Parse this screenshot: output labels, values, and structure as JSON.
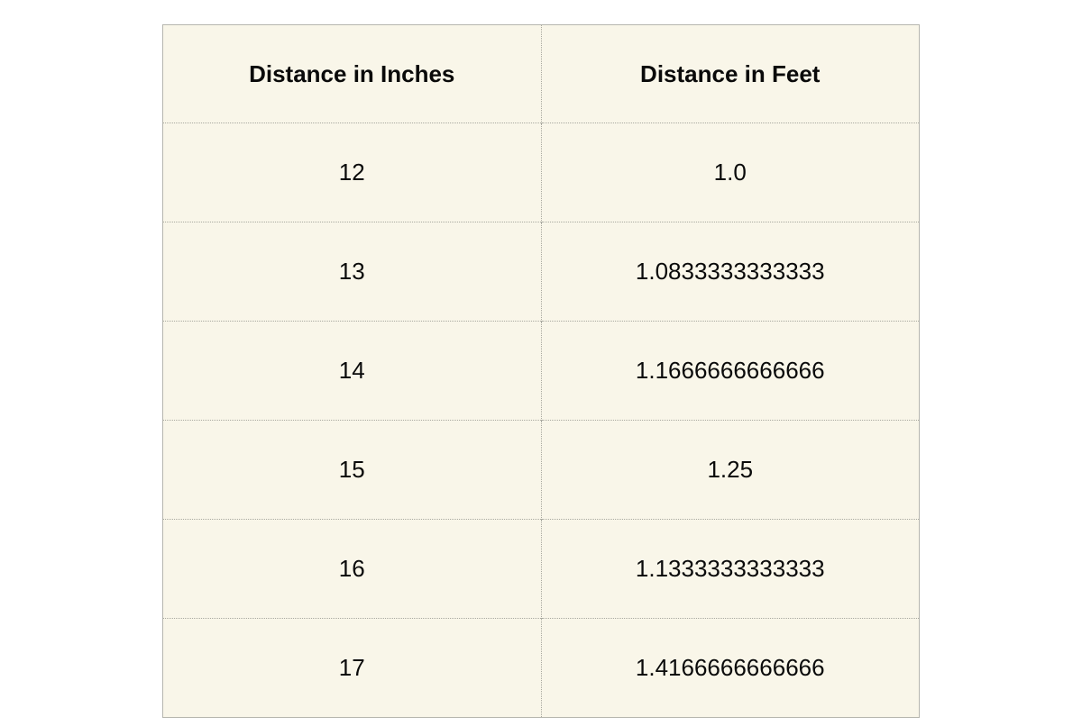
{
  "table": {
    "columns": [
      {
        "key": "inches",
        "header": "Distance in Inches"
      },
      {
        "key": "feet",
        "header": "Distance in Feet"
      }
    ],
    "rows": [
      {
        "inches": "12",
        "feet": "1.0"
      },
      {
        "inches": "13",
        "feet": "1.0833333333333"
      },
      {
        "inches": "14",
        "feet": "1.1666666666666"
      },
      {
        "inches": "15",
        "feet": "1.25"
      },
      {
        "inches": "16",
        "feet": "1.1333333333333"
      },
      {
        "inches": "17",
        "feet": "1.4166666666666"
      }
    ]
  },
  "chart_data": {
    "type": "table",
    "title": "",
    "columns": [
      "Distance in Inches",
      "Distance in Feet"
    ],
    "rows": [
      [
        "12",
        "1.0"
      ],
      [
        "13",
        "1.0833333333333"
      ],
      [
        "14",
        "1.1666666666666"
      ],
      [
        "15",
        "1.25"
      ],
      [
        "16",
        "1.1333333333333"
      ],
      [
        "17",
        "1.4166666666666"
      ]
    ],
    "xlabel": "",
    "ylabel": ""
  },
  "style": {
    "cell_background": "#f9f6e9",
    "page_background": "#ffffff",
    "border_color": "#b6b6ae",
    "divider_color": "#a9a9a0",
    "text_color": "#0a0a0a"
  }
}
